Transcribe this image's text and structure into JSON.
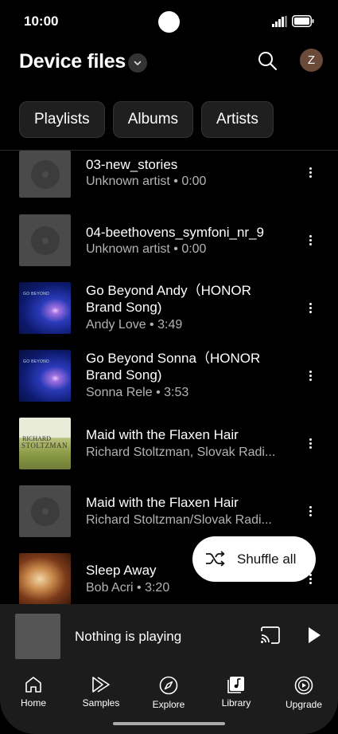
{
  "status": {
    "time": "10:00"
  },
  "header": {
    "title": "Device files",
    "avatar_letter": "Z"
  },
  "chips": [
    "Playlists",
    "Albums",
    "Artists"
  ],
  "songs": [
    {
      "title": "03-new_stories",
      "subtitle": "Unknown artist • 0:00",
      "art": "generic-album-art"
    },
    {
      "title": "04-beethovens_symfoni_nr_9",
      "subtitle": "Unknown artist • 0:00",
      "art": "generic-album-art"
    },
    {
      "title": "Go Beyond Andy（HONOR Brand Song)",
      "subtitle": "Andy Love • 3:49",
      "art": "go-beyond-art",
      "art_label": "GO BEYOND"
    },
    {
      "title": "Go Beyond Sonna（HONOR Brand Song)",
      "subtitle": "Sonna Rele • 3:53",
      "art": "go-beyond-art",
      "art_label": "GO BEYOND"
    },
    {
      "title": "Maid with the Flaxen Hair",
      "subtitle": "Richard Stoltzman, Slovak Radi...",
      "art": "richard-stoltzman-art",
      "art_label_1": "RICHARD",
      "art_label_2": "STOLTZMAN"
    },
    {
      "title": "Maid with the Flaxen Hair",
      "subtitle": "Richard Stoltzman/Slovak Radi...",
      "art": "generic-album-art"
    },
    {
      "title": "Sleep Away",
      "subtitle": "Bob Acri • 3:20",
      "art": "sleep-away-art"
    }
  ],
  "shuffle": {
    "label": "Shuffle all"
  },
  "player": {
    "status": "Nothing is playing"
  },
  "nav": [
    {
      "label": "Home",
      "icon": "home-icon"
    },
    {
      "label": "Samples",
      "icon": "samples-icon"
    },
    {
      "label": "Explore",
      "icon": "explore-icon"
    },
    {
      "label": "Library",
      "icon": "library-icon"
    },
    {
      "label": "Upgrade",
      "icon": "upgrade-icon"
    }
  ]
}
